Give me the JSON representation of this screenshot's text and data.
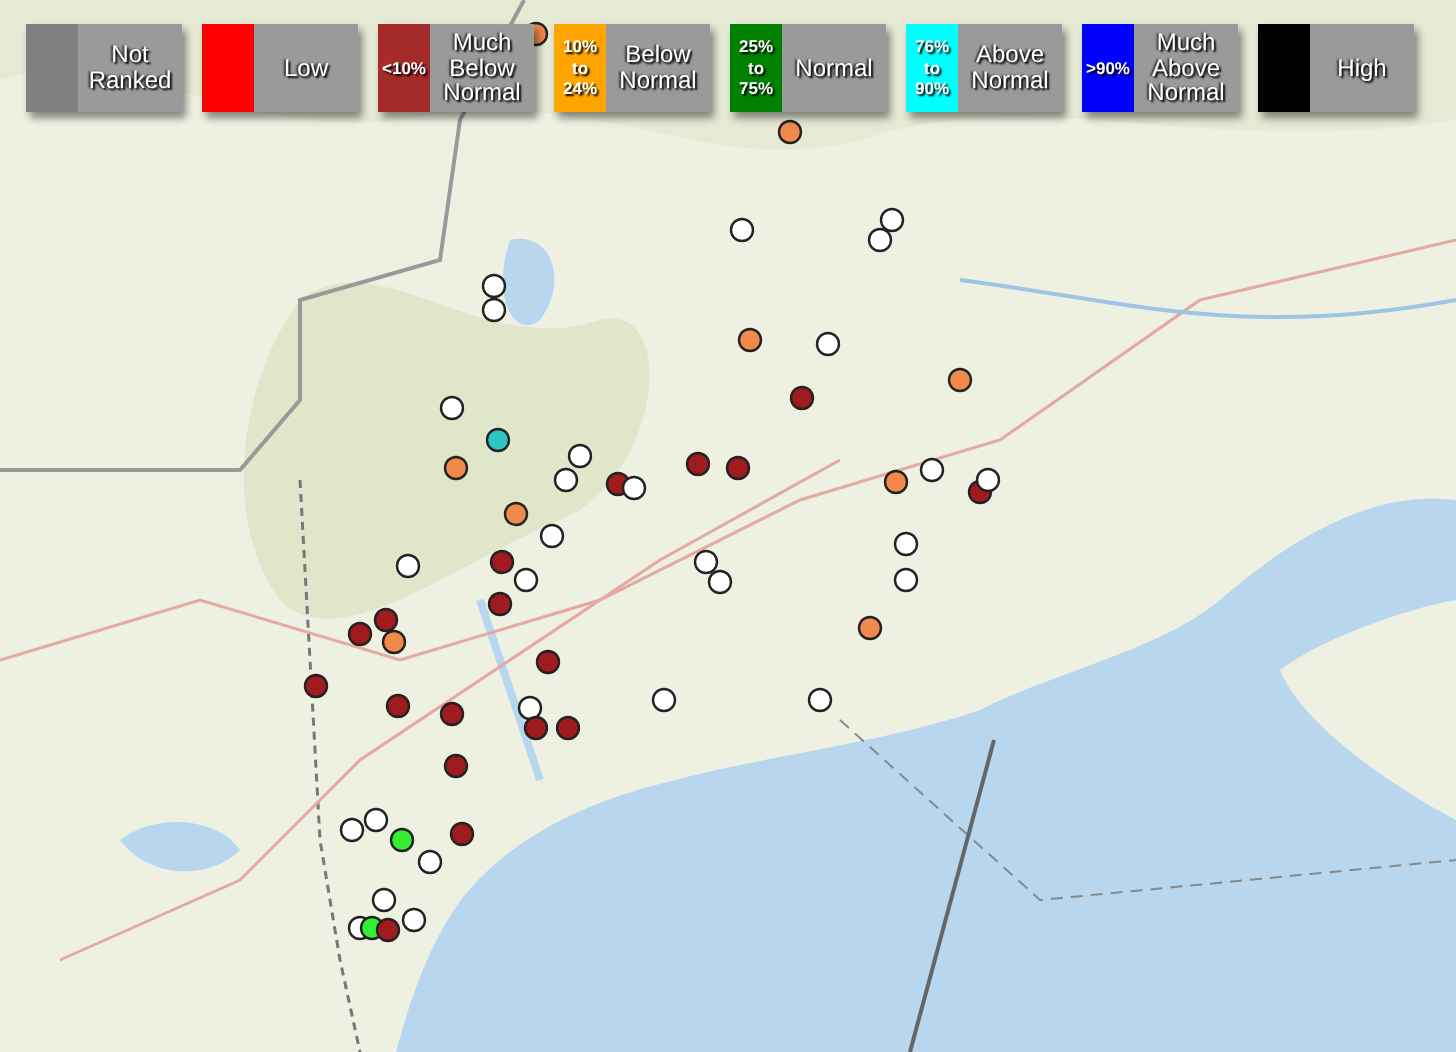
{
  "legend": [
    {
      "color": "#808080",
      "label": "Not Ranked"
    },
    {
      "color": "#ff0000",
      "label": "Low"
    },
    {
      "color": "#a52a2a",
      "range": "<10%",
      "label": "Much Below Normal"
    },
    {
      "color": "#ffa500",
      "range": "10% to 24%",
      "label": "Below Normal"
    },
    {
      "color": "#008000",
      "range": "25% to 75%",
      "label": "Normal"
    },
    {
      "color": "#00ffff",
      "range": "76% to 90%",
      "label": "Above Normal"
    },
    {
      "color": "#0000ff",
      "range": ">90%",
      "label": "Much Above Normal"
    },
    {
      "color": "#000000",
      "label": "High"
    }
  ],
  "gauges": [
    {
      "color": "#f08a4b"
    },
    {
      "color": "#f08a4b"
    },
    {
      "color": "#ffffff"
    },
    {
      "color": "#ffffff"
    },
    {
      "color": "#ffffff"
    },
    {
      "color": "#ffffff"
    },
    {
      "color": "#ffffff"
    },
    {
      "color": "#f08a4b"
    },
    {
      "color": "#ffffff"
    },
    {
      "color": "#f08a4b"
    },
    {
      "color": "#a01b1e"
    },
    {
      "color": "#ffffff"
    },
    {
      "color": "#2ec4c4"
    },
    {
      "color": "#f08a4b"
    },
    {
      "color": "#ffffff"
    },
    {
      "color": "#ffffff"
    },
    {
      "color": "#a01b1e"
    },
    {
      "color": "#ffffff"
    },
    {
      "color": "#a01b1e"
    },
    {
      "color": "#a01b1e"
    },
    {
      "color": "#f08a4b"
    },
    {
      "color": "#ffffff"
    },
    {
      "color": "#a01b1e"
    },
    {
      "color": "#ffffff"
    },
    {
      "color": "#f08a4b"
    },
    {
      "color": "#ffffff"
    },
    {
      "color": "#a01b1e"
    },
    {
      "color": "#ffffff"
    },
    {
      "color": "#ffffff"
    },
    {
      "color": "#ffffff"
    },
    {
      "color": "#ffffff"
    },
    {
      "color": "#ffffff"
    },
    {
      "color": "#ffffff"
    },
    {
      "color": "#a01b1e"
    },
    {
      "color": "#a01b1e"
    },
    {
      "color": "#a01b1e"
    },
    {
      "color": "#f08a4b"
    },
    {
      "color": "#f08a4b"
    },
    {
      "color": "#a01b1e"
    },
    {
      "color": "#a01b1e"
    },
    {
      "color": "#a01b1e"
    },
    {
      "color": "#a01b1e"
    },
    {
      "color": "#ffffff"
    },
    {
      "color": "#a01b1e"
    },
    {
      "color": "#a01b1e"
    },
    {
      "color": "#ffffff"
    },
    {
      "color": "#ffffff"
    },
    {
      "color": "#a01b1e"
    },
    {
      "color": "#a01b1e"
    },
    {
      "color": "#ffffff"
    },
    {
      "color": "#ffffff"
    },
    {
      "color": "#33ee33"
    },
    {
      "color": "#ffffff"
    },
    {
      "color": "#ffffff"
    },
    {
      "color": "#ffffff"
    },
    {
      "color": "#33ee33"
    },
    {
      "color": "#a01b1e"
    },
    {
      "color": "#ffffff"
    }
  ]
}
